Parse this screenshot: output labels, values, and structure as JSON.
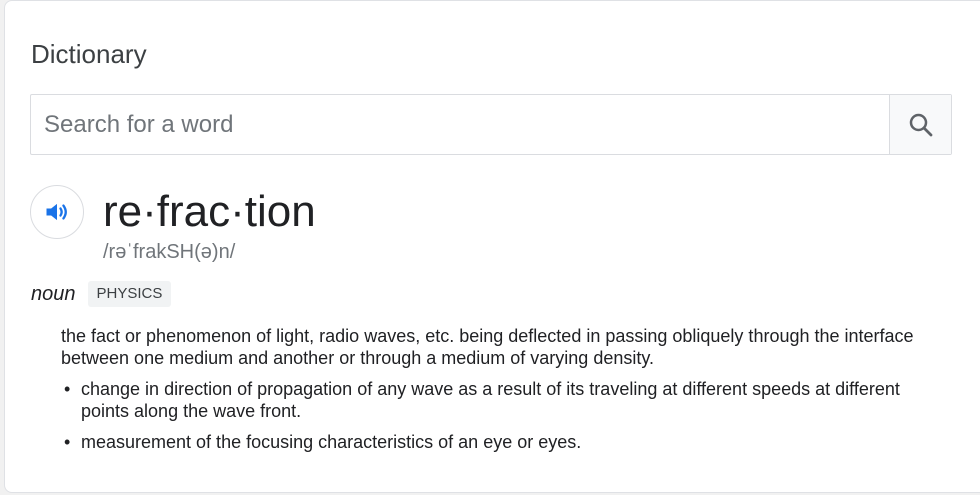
{
  "widget": {
    "title": "Dictionary"
  },
  "search": {
    "placeholder": "Search for a word",
    "value": ""
  },
  "entry": {
    "headword": "re·frac·tion",
    "phonetic": "/rəˈfrakSH(ə)n/",
    "part_of_speech": "noun",
    "domain_label": "PHYSICS",
    "definition": "the fact or phenomenon of light, radio waves, etc. being deflected in passing obliquely through the interface between one medium and another or through a medium of varying density.",
    "sub_definitions": [
      "change in direction of propagation of any wave as a result of its traveling at different speeds at different points along the wave front.",
      "measurement of the focusing characteristics of an eye or eyes."
    ]
  },
  "icons": {
    "search": "search-icon",
    "speaker": "speaker-icon"
  },
  "colors": {
    "accent": "#1a73e8",
    "text": "#202124",
    "muted": "#70757a"
  }
}
